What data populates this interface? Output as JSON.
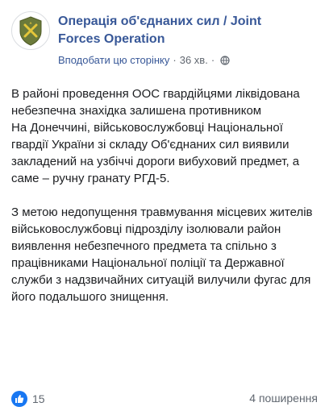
{
  "post": {
    "page_name": "Операція об'єднаних сил / Joint Forces Operation",
    "like_page_label": "Вподобати цю сторінку",
    "separator": "·",
    "timestamp": "36 хв.",
    "paragraphs": [
      "В районі проведення ООС гвардійцями ліквідована небезпечна знахідка залишена противником\nНа Донеччині, військовослужбовці Національної гвардії України зі складу Об'єднаних сил виявили закладений на узбіччі дороги вибуховий предмет, а саме – ручну гранату РГД-5.",
      "З метою недопущення травмування місцевих жителів військовослужбовці підрозділу ізолювали район виявлення небезпечного предмета та спільно з працівниками Національної поліції та Державної служби з надзвичайних ситуацій вилучили фугас для його подальшого знищення."
    ],
    "reaction_count": "15",
    "shares_label": "4 поширення"
  },
  "icons": {
    "avatar": "jfo-emblem-icon",
    "privacy": "globe-icon",
    "reaction": "thumbs-up-icon"
  },
  "colors": {
    "link": "#385898",
    "meta": "#616770",
    "like_badge": "#1877f2",
    "emblem_green": "#6b7a3a",
    "emblem_yellow": "#e4c63a"
  }
}
